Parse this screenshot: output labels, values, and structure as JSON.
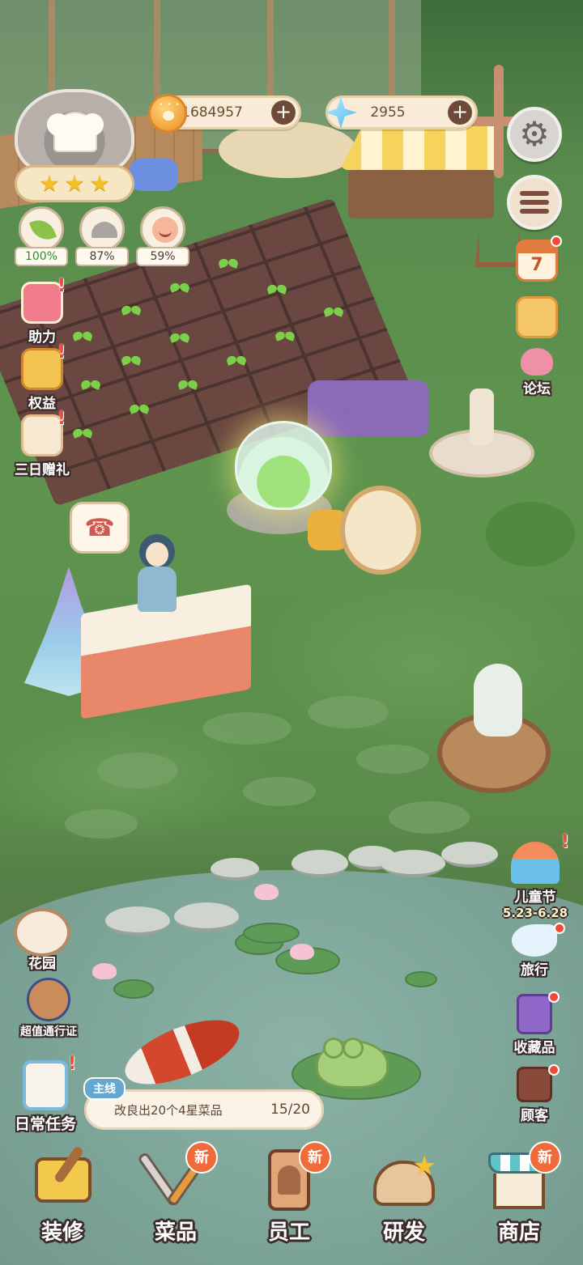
{
  "currencies": {
    "coins": {
      "value": "1684957",
      "icon": "paw-coin-icon"
    },
    "gems": {
      "value": "2955",
      "icon": "blue-star-gem-icon"
    },
    "add_label": "+"
  },
  "chef": {
    "stars": 3,
    "star_glyph": "★",
    "icon": "chef-hat-icon"
  },
  "stats": [
    {
      "icon": "leaf-icon",
      "value": "100%",
      "color": "#2e8b2e"
    },
    {
      "icon": "cloche-icon",
      "value": "87%",
      "color": "#4a3c30"
    },
    {
      "icon": "smile-icon",
      "value": "59%",
      "color": "#4a3c30"
    }
  ],
  "left_menu": {
    "assist": "助力",
    "benefits": "权益",
    "gift": "三日赠礼"
  },
  "right_menu": {
    "settings_icon": "gear-icon",
    "menu_icon": "menu-icon",
    "calendar_day": "7",
    "forum": "论坛",
    "children_day": "儿童节",
    "children_day_dates": "5.23-6.28",
    "travel": "旅行",
    "collection": "收藏品",
    "customers": "顾客"
  },
  "garden": "花园",
  "pass": "超值通行证",
  "daily_tasks": "日常任务",
  "quest": {
    "tag": "主线",
    "text": "改良出20个4星菜品",
    "progress": "15/20"
  },
  "bottom_nav": [
    {
      "label": "装修",
      "icon": "paint-roller-icon",
      "new": false
    },
    {
      "label": "菜品",
      "icon": "utensils-icon",
      "new": true
    },
    {
      "label": "员工",
      "icon": "staff-card-icon",
      "new": true
    },
    {
      "label": "研发",
      "icon": "cooking-pot-icon",
      "new": false
    },
    {
      "label": "商店",
      "icon": "shop-icon",
      "new": true
    }
  ],
  "new_label": "新",
  "colors": {
    "grass": "#5f944f",
    "pond": "#7ca497",
    "panel": "#f8ecd8",
    "notification": "#ef4b37"
  }
}
